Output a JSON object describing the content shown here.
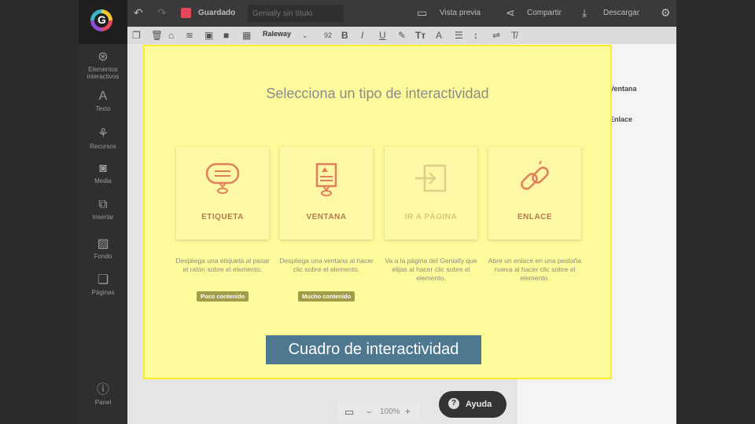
{
  "topbar": {
    "saved_label": "Guardado",
    "title_placeholder": "Genially sin título",
    "preview_label": "Vista previa",
    "share_label": "Compartir",
    "download_label": "Descargar"
  },
  "toolbar": {
    "font_name": "Raleway",
    "font_size": "92"
  },
  "sidebar": {
    "items": [
      {
        "label": "Elementos interactivos",
        "icon": "interactive-icon"
      },
      {
        "label": "Texto",
        "icon": "text-icon"
      },
      {
        "label": "Recursos",
        "icon": "resources-icon"
      },
      {
        "label": "Media",
        "icon": "camera-icon"
      },
      {
        "label": "Insertar",
        "icon": "insert-icon"
      },
      {
        "label": "Fondo",
        "icon": "background-icon"
      },
      {
        "label": "Páginas",
        "icon": "pages-icon"
      },
      {
        "label": "Panel",
        "icon": "info-icon"
      }
    ]
  },
  "right_panel": {
    "items": [
      {
        "label": "Ventana",
        "icon": "window-icon"
      },
      {
        "label": "Enlace",
        "icon": "link-icon"
      }
    ]
  },
  "dialog": {
    "title": "Selecciona un tipo de interactividad",
    "cards": [
      {
        "label": "ETIQUETA",
        "icon": "tooltip-icon",
        "description": "Despliega una etiqueta al pasar el ratón sobre el elemento.",
        "badge": "Poco contenido"
      },
      {
        "label": "VENTANA",
        "icon": "window-icon",
        "description": "Despliega una ventana al hacer clic sobre el elemento.",
        "badge": "Mucho contenido"
      },
      {
        "label": "IR A PÁGINA",
        "icon": "goto-page-icon",
        "description": "Va a la página del Genially que elijas al hacer clic sobre el elemento.",
        "badge": ""
      },
      {
        "label": "ENLACE",
        "icon": "link-icon",
        "description": "Abre un enlace en una pestaña nueva al hacer clic sobre el elemento.",
        "badge": ""
      }
    ]
  },
  "caption": "Cuadro de interactividad",
  "zoom": {
    "value": "100%"
  },
  "help": {
    "label": "Ayuda"
  },
  "colors": {
    "overlay_bg": "#fdfa9b",
    "overlay_border": "#ffeb2a",
    "caption_bg": "#4e7790",
    "icon_accent": "#e0805a"
  }
}
